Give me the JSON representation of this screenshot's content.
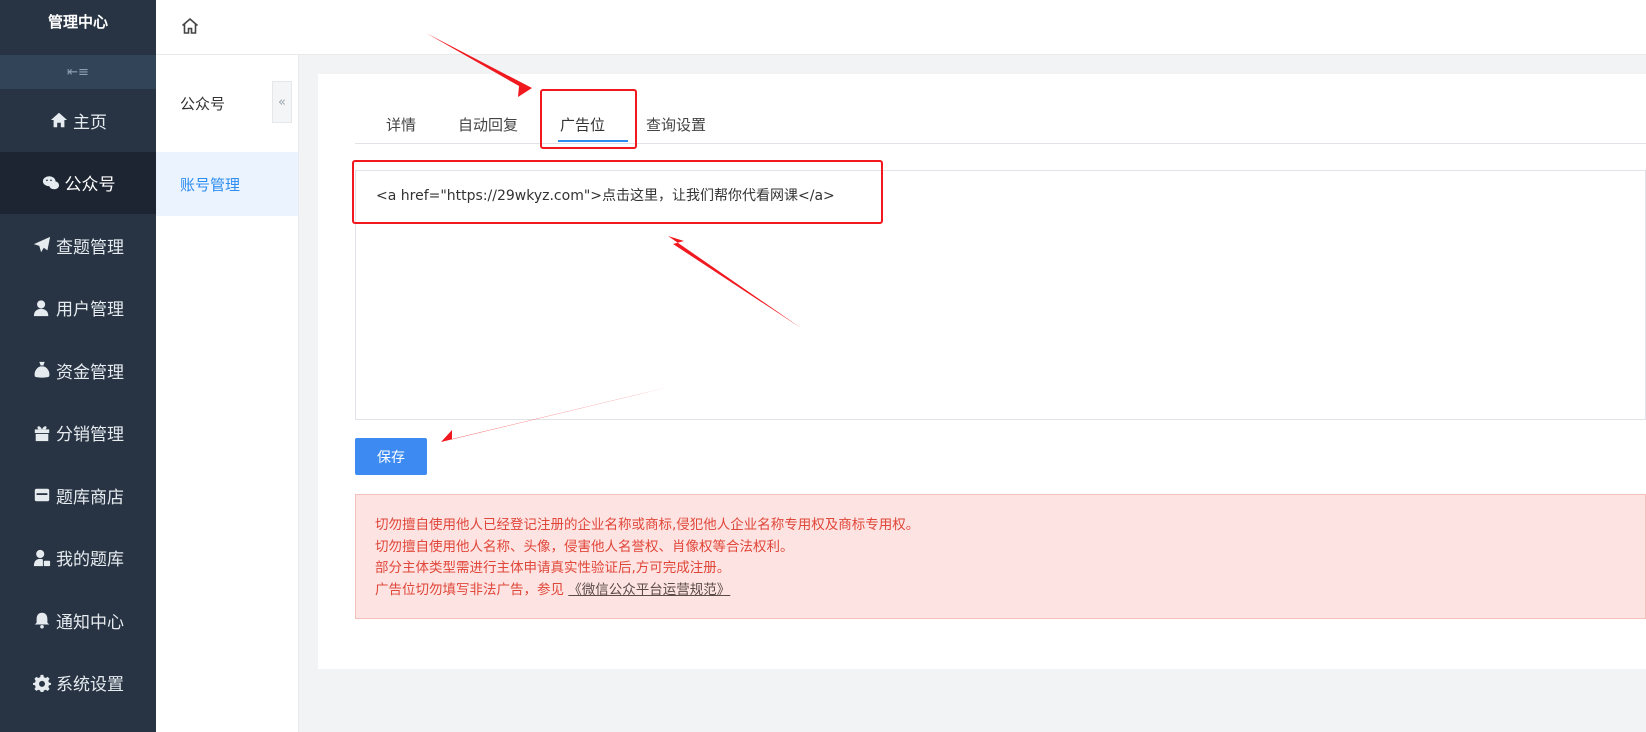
{
  "sidebar": {
    "title": "管理中心",
    "collapse_icon": "menu-collapse-icon",
    "items": [
      {
        "label": "主页",
        "icon": "home-icon"
      },
      {
        "label": "公众号",
        "icon": "wechat-icon"
      },
      {
        "label": "查题管理",
        "icon": "paper-plane-icon"
      },
      {
        "label": "用户管理",
        "icon": "user-icon"
      },
      {
        "label": "资金管理",
        "icon": "money-bag-icon"
      },
      {
        "label": "分销管理",
        "icon": "gift-icon"
      },
      {
        "label": "题库商店",
        "icon": "store-icon"
      },
      {
        "label": "我的题库",
        "icon": "user-lock-icon"
      },
      {
        "label": "通知中心",
        "icon": "bell-icon"
      },
      {
        "label": "系统设置",
        "icon": "gear-icon"
      }
    ]
  },
  "submenu": {
    "title": "公众号",
    "items": [
      {
        "label": "账号管理"
      }
    ],
    "fold_glyph": "«"
  },
  "tabs": [
    {
      "label": "详情"
    },
    {
      "label": "自动回复"
    },
    {
      "label": "广告位"
    },
    {
      "label": "查询设置"
    }
  ],
  "editor": {
    "content": "<a href=\"https://29wkyz.com\">点击这里，让我们帮你代看网课</a>"
  },
  "save_label": "保存",
  "notice": {
    "lines": [
      "切勿擅自使用他人已经登记注册的企业名称或商标,侵犯他人企业名称专用权及商标专用权。",
      "切勿擅自使用他人名称、头像，侵害他人名誉权、肖像权等合法权利。",
      "部分主体类型需进行主体申请真实性验证后,方可完成注册。"
    ],
    "last_line_prefix": "广告位切勿填写非法广告，参见 ",
    "link_text": "《微信公众平台运营规范》"
  },
  "colors": {
    "sidebar_bg": "#283443",
    "accent": "#2d8cf0",
    "save_button": "#3d8bf2",
    "annotation_red": "#f0191f",
    "notice_text": "#e0463a"
  }
}
